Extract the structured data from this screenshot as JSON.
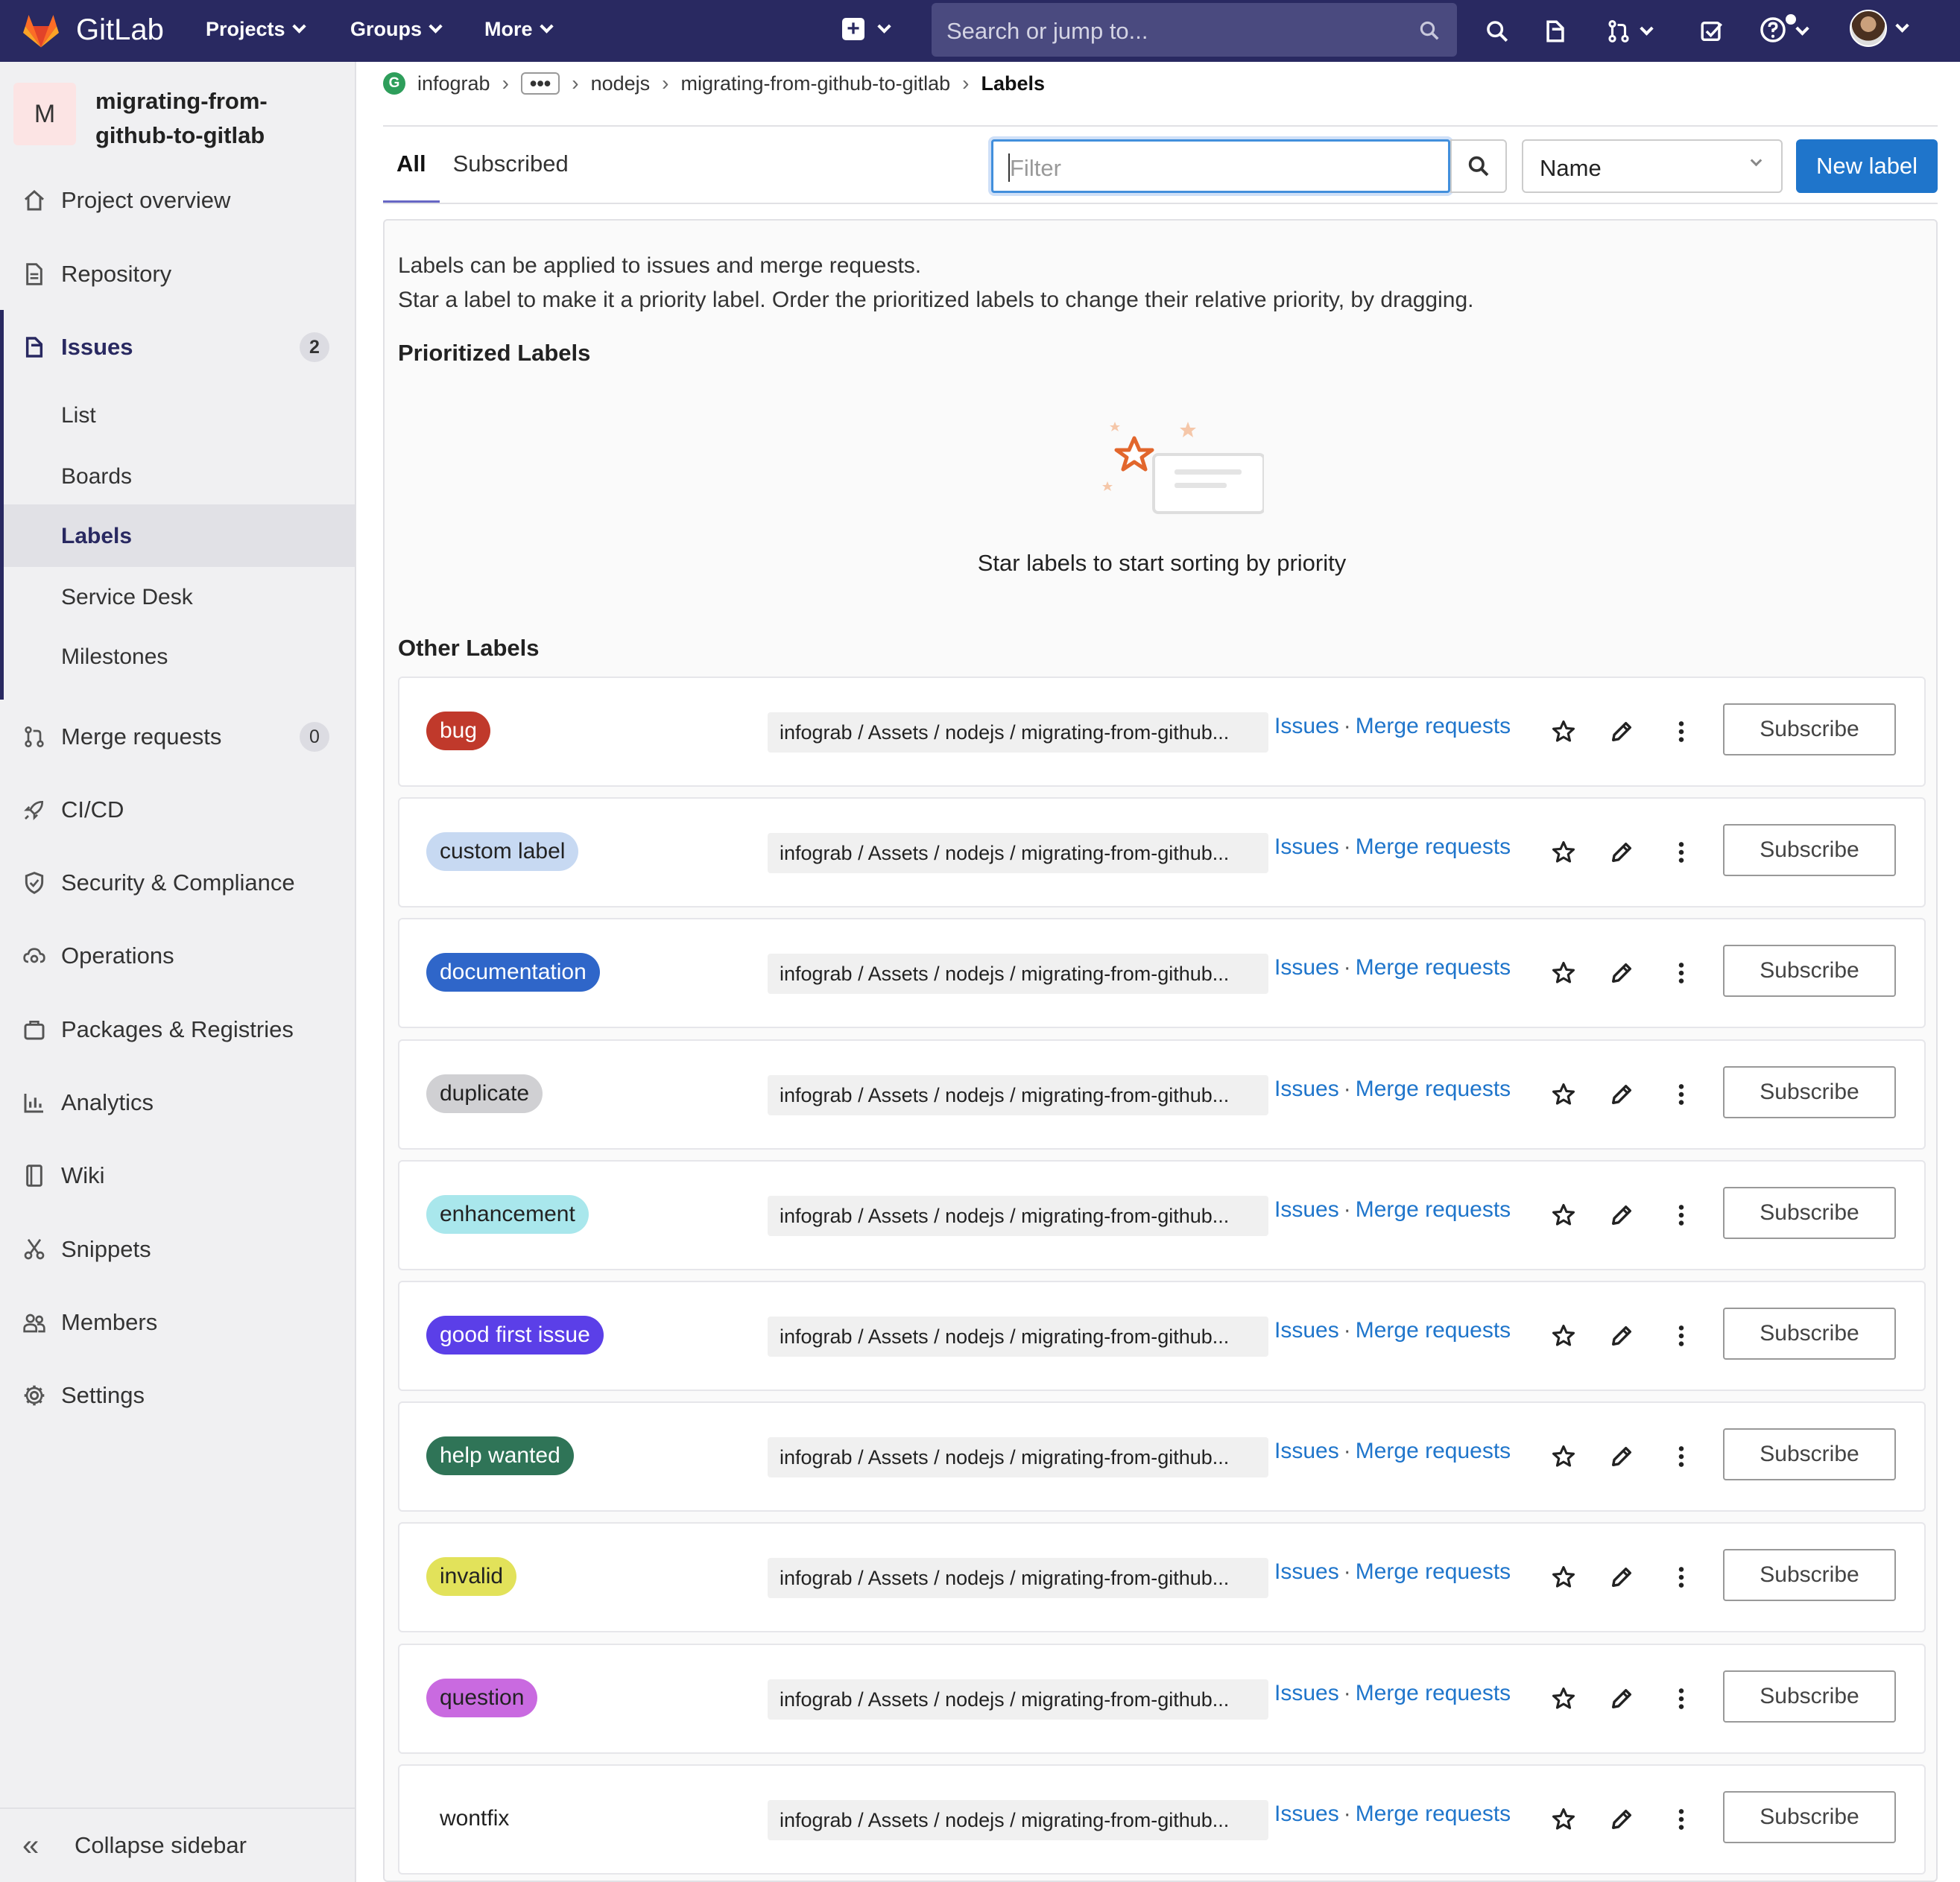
{
  "topbar": {
    "brand": "GitLab",
    "menus": [
      "Projects",
      "Groups",
      "More"
    ],
    "search_placeholder": "Search or jump to..."
  },
  "sidebar": {
    "project_initial": "M",
    "project_name": "migrating-from-github-to-gitlab",
    "items": [
      {
        "label": "Project overview",
        "icon": "home-icon"
      },
      {
        "label": "Repository",
        "icon": "document-icon"
      },
      {
        "label": "Issues",
        "icon": "issues-icon",
        "count": "2"
      },
      {
        "label": "Merge requests",
        "icon": "merge-request-icon",
        "count": "0"
      },
      {
        "label": "CI/CD",
        "icon": "rocket-icon"
      },
      {
        "label": "Security & Compliance",
        "icon": "shield-icon"
      },
      {
        "label": "Operations",
        "icon": "cloud-gear-icon"
      },
      {
        "label": "Packages & Registries",
        "icon": "package-icon"
      },
      {
        "label": "Analytics",
        "icon": "chart-icon"
      },
      {
        "label": "Wiki",
        "icon": "book-icon"
      },
      {
        "label": "Snippets",
        "icon": "scissors-icon"
      },
      {
        "label": "Members",
        "icon": "users-icon"
      },
      {
        "label": "Settings",
        "icon": "settings-icon"
      }
    ],
    "issue_subitems": [
      "List",
      "Boards",
      "Labels",
      "Service Desk",
      "Milestones"
    ],
    "collapse_label": "Collapse sidebar"
  },
  "breadcrumb": {
    "group": "infograb",
    "group_logo": "G",
    "ellipsis": "•••",
    "parent": "nodejs",
    "project": "migrating-from-github-to-gitlab",
    "current": "Labels"
  },
  "tabs": [
    "All",
    "Subscribed"
  ],
  "filter_placeholder": "Filter",
  "sort_value": "Name",
  "new_label_button": "New label",
  "description": [
    "Labels can be applied to issues and merge requests.",
    "Star a label to make it a priority label. Order the prioritized labels to change their relative priority, by dragging."
  ],
  "prioritized_heading": "Prioritized Labels",
  "empty_state_text": "Star labels to start sorting by priority",
  "other_heading": "Other Labels",
  "label_path": "infograb / Assets / nodejs / migrating-from-github...",
  "issues_link": "Issues",
  "link_separator": "·",
  "merge_requests_link": "Merge requests",
  "subscribe_label": "Subscribe",
  "labels": [
    {
      "name": "bug",
      "bg": "#c0392b",
      "fg": "#ffffff"
    },
    {
      "name": "custom label",
      "bg": "#c7d9f2",
      "fg": "#222222"
    },
    {
      "name": "documentation",
      "bg": "#2f66c9",
      "fg": "#ffffff"
    },
    {
      "name": "duplicate",
      "bg": "#d0d0d3",
      "fg": "#222222"
    },
    {
      "name": "enhancement",
      "bg": "#a9e7ec",
      "fg": "#222222"
    },
    {
      "name": "good first issue",
      "bg": "#5b3fe8",
      "fg": "#ffffff"
    },
    {
      "name": "help wanted",
      "bg": "#2f7457",
      "fg": "#ffffff"
    },
    {
      "name": "invalid",
      "bg": "#e2e25a",
      "fg": "#222222"
    },
    {
      "name": "question",
      "bg": "#c96ae0",
      "fg": "#222222"
    },
    {
      "name": "wontfix",
      "bg": "#ffffff",
      "fg": "#222222"
    }
  ],
  "colors": {
    "navbar": "#292961",
    "primary": "#1f75cb",
    "link": "#1f75cb"
  }
}
